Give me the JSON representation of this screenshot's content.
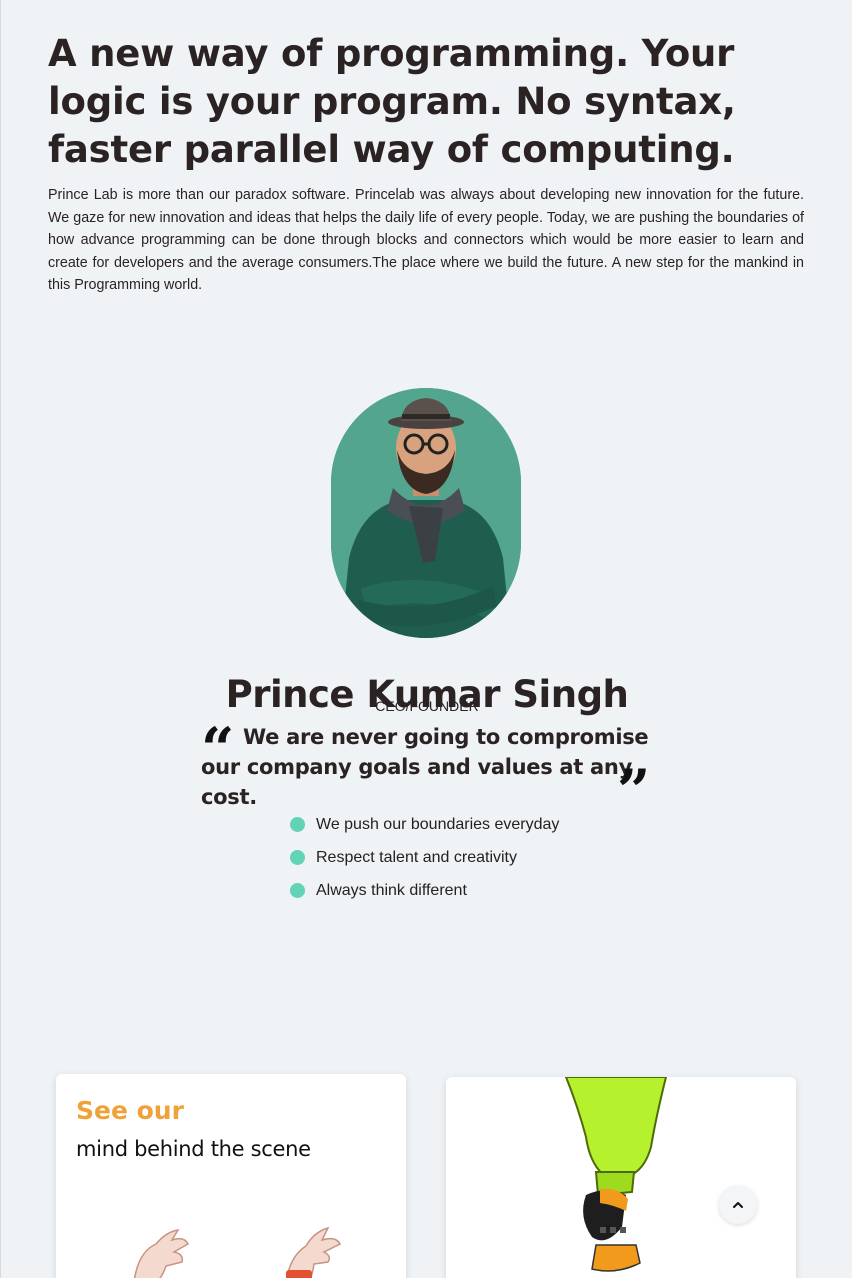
{
  "intro": {
    "headline": "A new way of programming. Your logic is your program. No syntax, faster parallel way of computing.",
    "body": "Prince Lab is more than our paradox software. Princelab was always about developing new innovation for the future. We gaze for new innovation and ideas that helps the daily life of every people. Today, we are pushing the boundaries of how advance programming can be done through blocks and connectors which would be more easier to learn and create for developers and the average consumers.The place where we build the future. A new step for the mankind in this Programming world."
  },
  "founder": {
    "name": "Prince Kumar Singh",
    "role": "CEO/FOUNDER",
    "quote": "We are never going to compromise our company goals and values at any cost.",
    "quote_open": "“",
    "quote_close": "”",
    "values": [
      "We push our boundaries everyday",
      "Respect talent and creativity",
      "Always think different"
    ],
    "portrait_bg": "#53a58d",
    "bullet_color": "#63d3b8"
  },
  "cards": {
    "team": {
      "kicker": "See our",
      "title": "mind behind the scene",
      "kicker_color": "#f0a23a"
    }
  },
  "scroll_top": {
    "icon": "chevron-up-icon"
  }
}
